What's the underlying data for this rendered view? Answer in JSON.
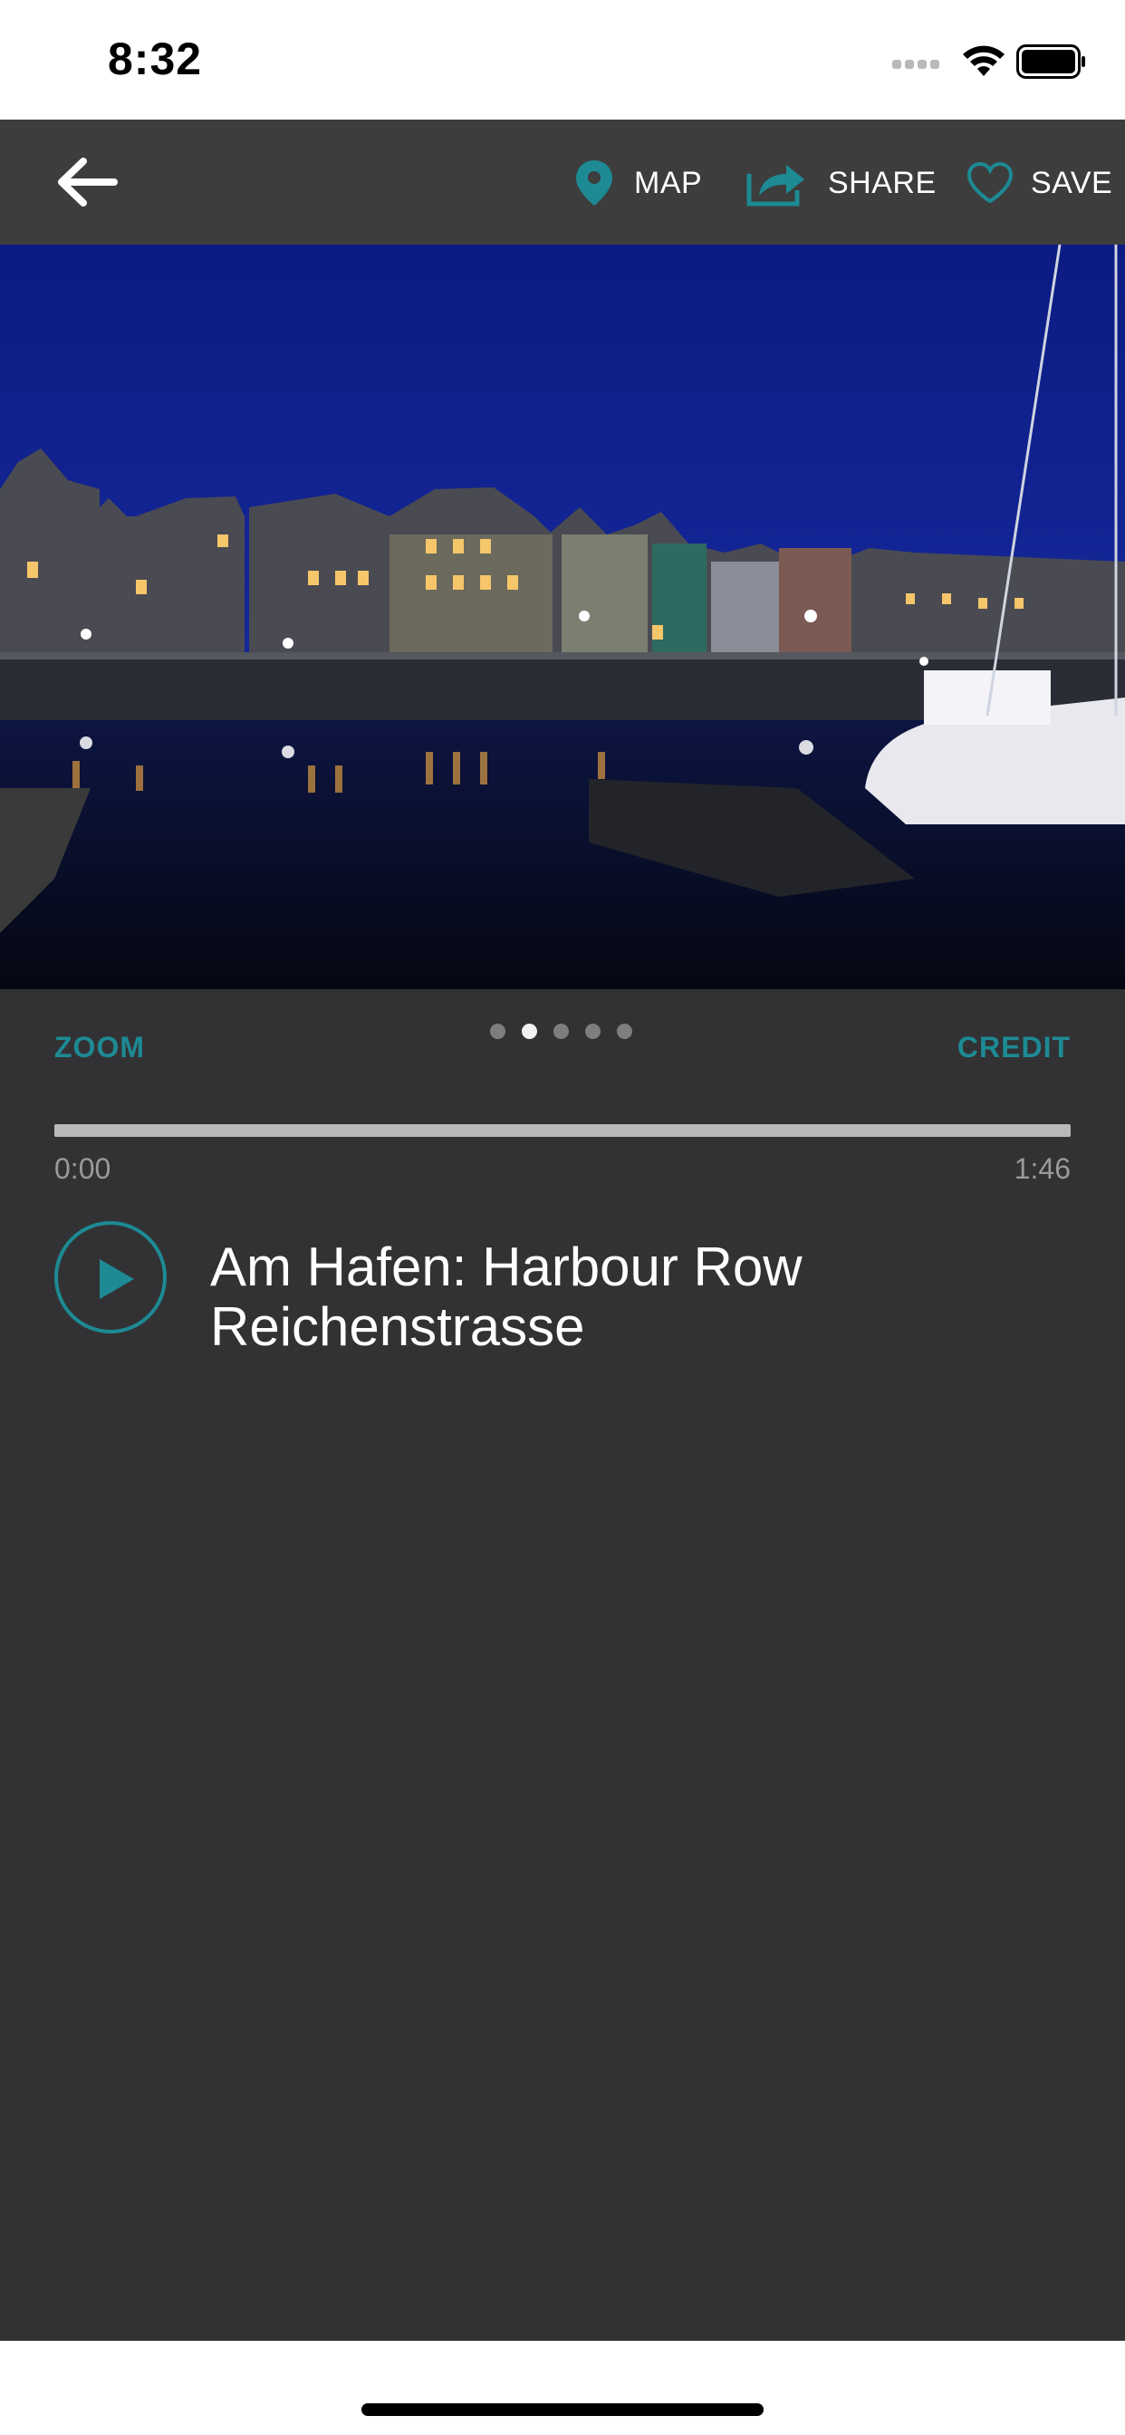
{
  "status_bar": {
    "time": "8:32",
    "icons": [
      "cellular-signal-icon",
      "wifi-icon",
      "battery-icon"
    ]
  },
  "app_bar": {
    "back_icon": "arrow-left-icon",
    "actions": [
      {
        "label": "MAP",
        "icon": "map-pin-icon"
      },
      {
        "label": "SHARE",
        "icon": "share-icon"
      },
      {
        "label": "SAVE",
        "icon": "heart-icon"
      }
    ]
  },
  "hero": {
    "image": "night harbour with illuminated gabled houses reflected in water and a moored sailboat",
    "page_count": 5,
    "active_page": 2
  },
  "gallery_controls": {
    "zoom_label": "ZOOM",
    "credit_label": "CREDIT"
  },
  "player": {
    "progress": 0,
    "elapsed": "0:00",
    "duration": "1:46",
    "play_icon": "play-icon",
    "title": "Am Hafen: Harbour Row Reichenstrasse"
  },
  "colors": {
    "accent": "#1d8a94",
    "app_bar_bg": "#3d3d3e",
    "content_bg": "#323234",
    "text_primary": "#ffffff",
    "text_muted": "#9a9a9c"
  }
}
